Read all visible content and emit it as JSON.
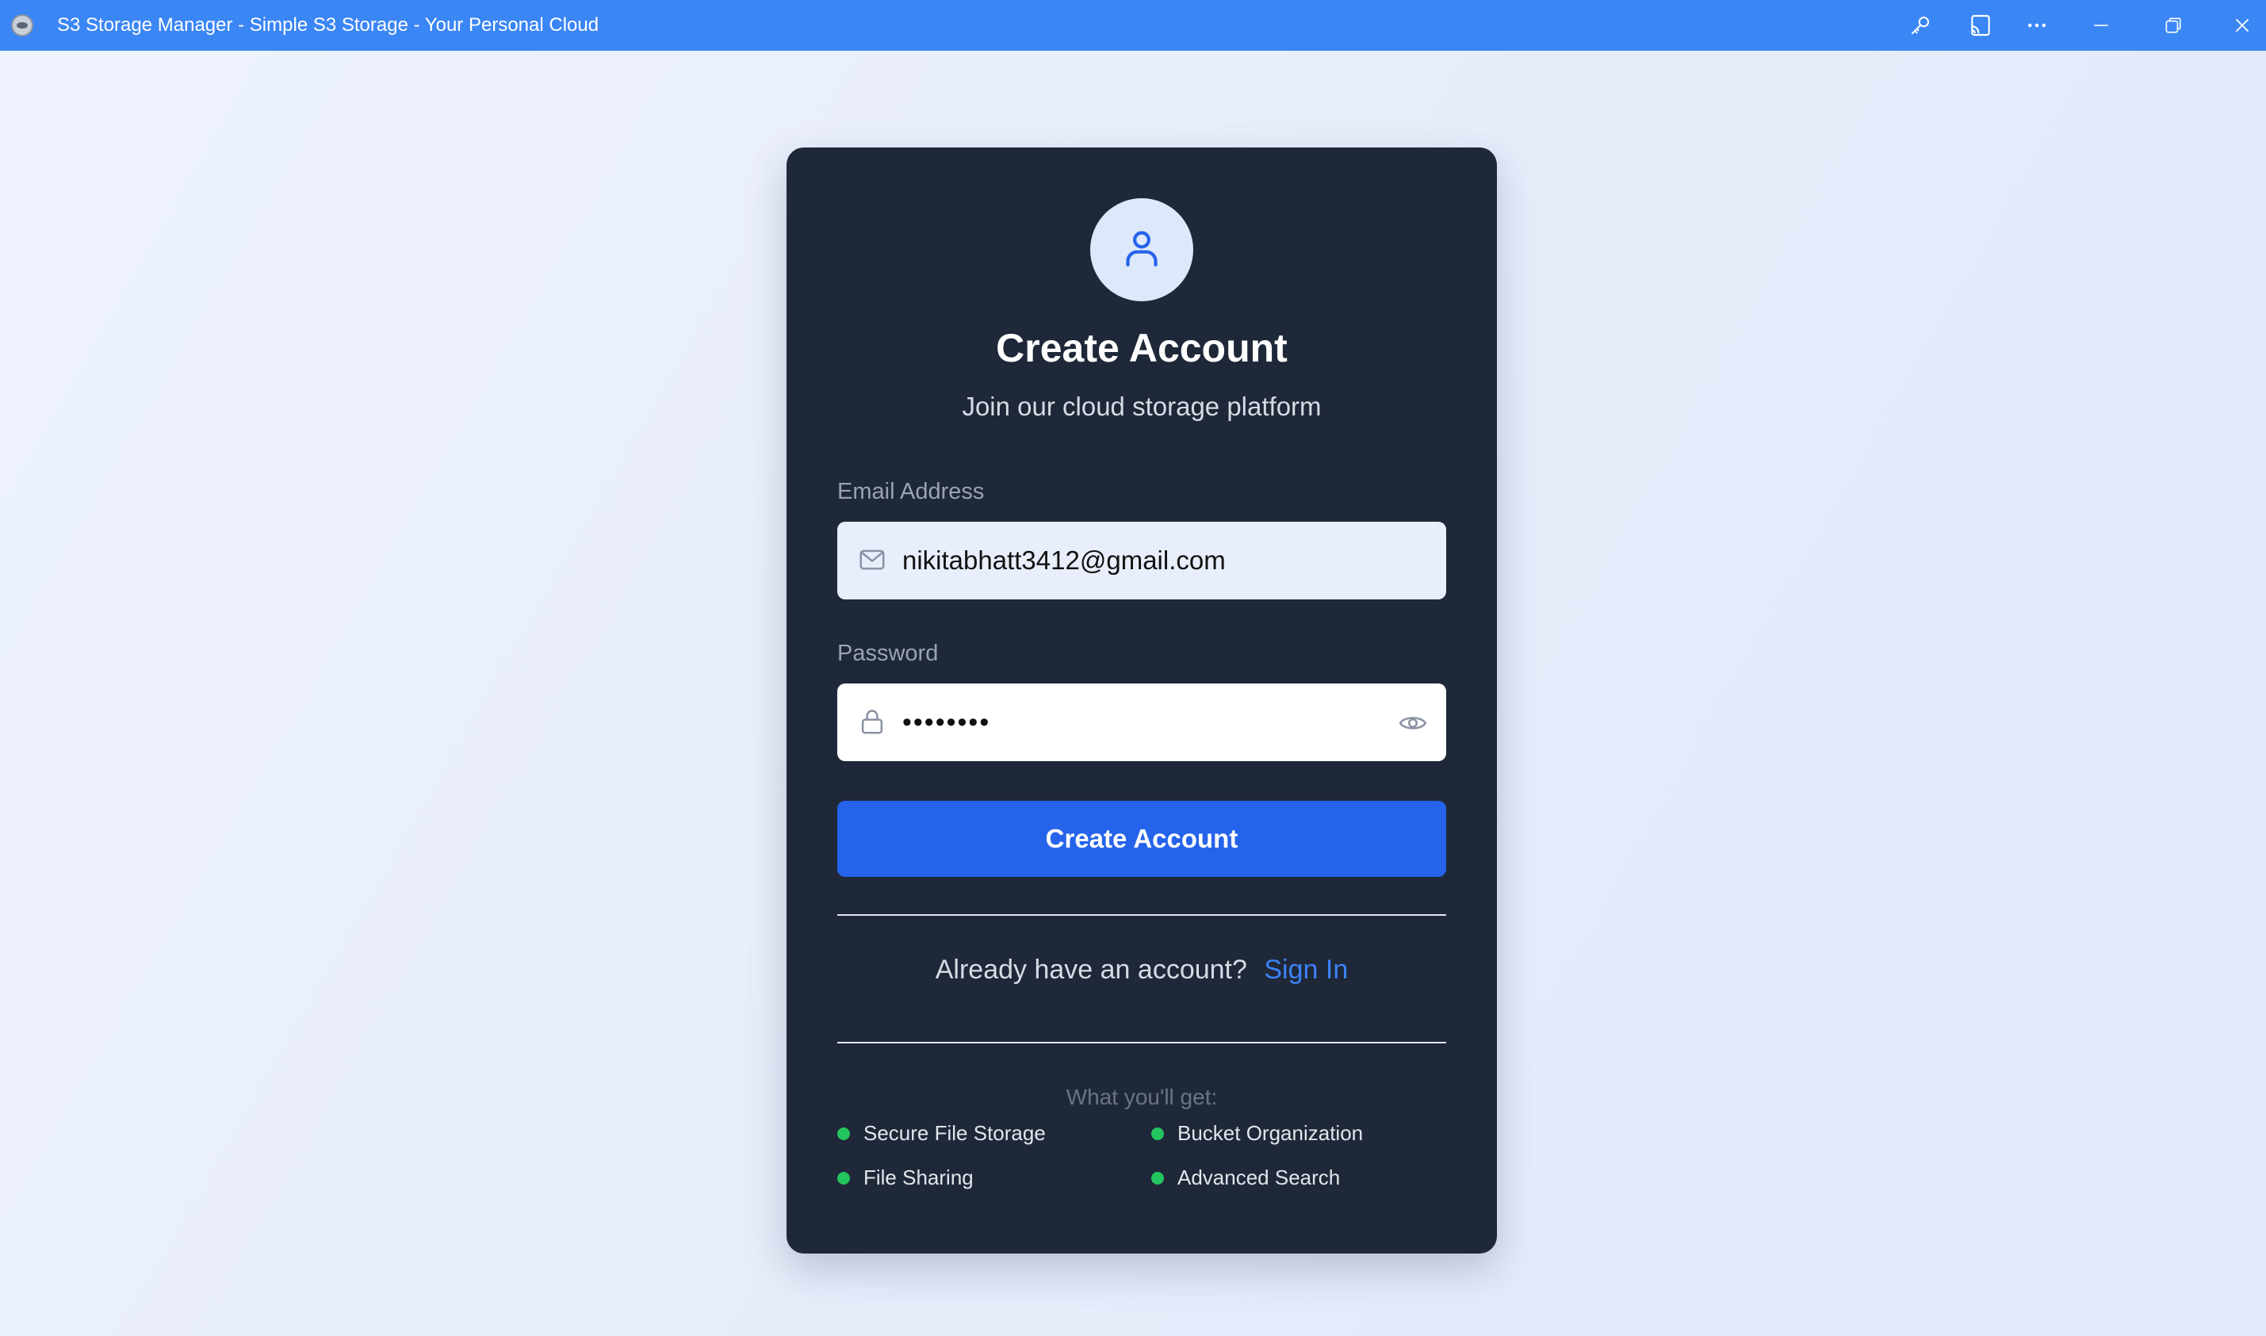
{
  "window": {
    "title": "S3 Storage Manager - Simple S3 Storage - Your Personal Cloud",
    "icons": [
      "app-icon",
      "key-icon",
      "cast-icon",
      "more-icon",
      "minimize-icon",
      "restore-icon",
      "close-icon"
    ]
  },
  "card": {
    "title": "Create Account",
    "subtitle": "Join our cloud storage platform",
    "email": {
      "label": "Email Address",
      "value": "nikitabhatt3412@gmail.com"
    },
    "password": {
      "label": "Password",
      "value": "••••••••"
    },
    "submit_label": "Create Account",
    "signin_prompt": "Already have an account?",
    "signin_link": "Sign In",
    "features_heading": "What you'll get:",
    "features": [
      "Secure File Storage",
      "Bucket Organization",
      "File Sharing",
      "Advanced Search"
    ]
  },
  "colors": {
    "titlebar": "#3b86f5",
    "card": "#1f2838",
    "primary": "#2563eb",
    "link": "#3b82f6",
    "feature_dot": "#22c55e"
  }
}
